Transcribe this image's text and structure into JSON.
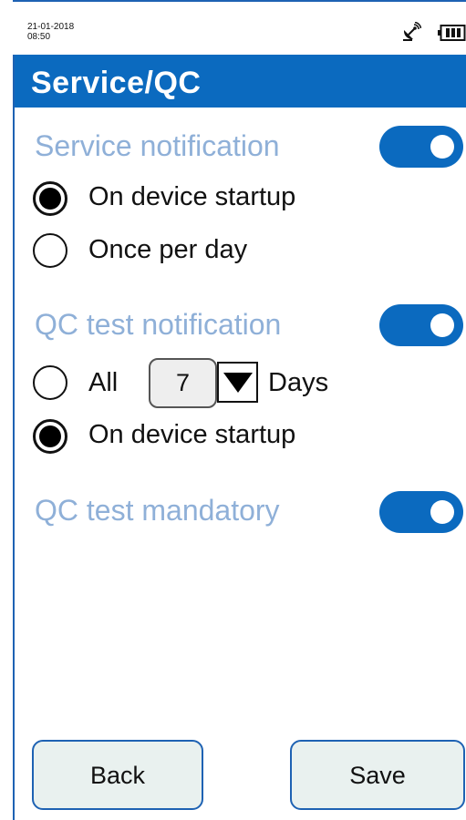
{
  "status": {
    "date": "21-01-2018",
    "time": "08:50",
    "icons": [
      "satellite-icon",
      "battery-icon"
    ]
  },
  "header": {
    "title": "Service/QC"
  },
  "service_notification": {
    "label": "Service notification",
    "enabled": true,
    "options": [
      {
        "label": "On device startup",
        "selected": true
      },
      {
        "label": "Once per day",
        "selected": false
      }
    ]
  },
  "qc_test_notification": {
    "label": "QC test notification",
    "enabled": true,
    "all_label": "All",
    "days_value": "7",
    "days_label": "Days",
    "options": [
      {
        "label": "All",
        "selected": false
      },
      {
        "label": "On device startup",
        "selected": true
      }
    ]
  },
  "qc_test_mandatory": {
    "label": "QC test mandatory",
    "enabled": true
  },
  "footer": {
    "back_label": "Back",
    "save_label": "Save"
  },
  "colors": {
    "accent": "#0b6abf",
    "section_label": "#8fb0d8",
    "button_bg": "#e9f1ef"
  }
}
